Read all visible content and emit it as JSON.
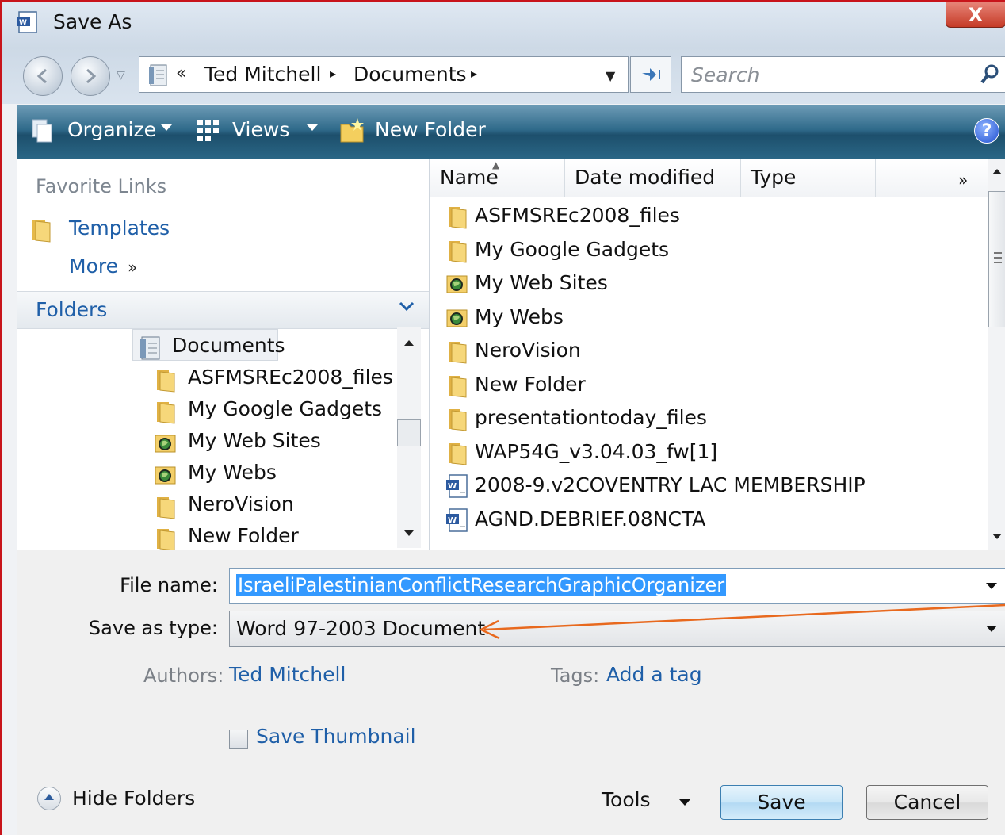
{
  "window": {
    "title": "Save As",
    "close_label": "X"
  },
  "address": {
    "prefix": "«",
    "crumbs": [
      "Ted Mitchell",
      "Documents"
    ],
    "separator": "▸"
  },
  "search": {
    "placeholder": "Search"
  },
  "toolbar": {
    "organize": "Organize",
    "views": "Views",
    "new_folder": "New Folder",
    "help": "?"
  },
  "nav": {
    "favorites_header": "Favorite Links",
    "favorites": [
      "Templates"
    ],
    "more": "More",
    "more_chevron": "»",
    "folders_label": "Folders",
    "tree": [
      {
        "label": "Documents",
        "icon": "documents-icon"
      },
      {
        "label": "ASFMSREc2008_files",
        "icon": "folder-icon"
      },
      {
        "label": "My Google Gadgets",
        "icon": "folder-icon"
      },
      {
        "label": "My Web Sites",
        "icon": "web-folder-icon"
      },
      {
        "label": "My Webs",
        "icon": "web-folder-icon"
      },
      {
        "label": "NeroVision",
        "icon": "folder-icon"
      },
      {
        "label": "New Folder",
        "icon": "folder-icon"
      }
    ]
  },
  "filelist": {
    "columns": [
      "Name",
      "Date modified",
      "Type"
    ],
    "more_columns": "»",
    "items": [
      {
        "label": "ASFMSREc2008_files",
        "icon": "folder-icon"
      },
      {
        "label": "My Google Gadgets",
        "icon": "folder-icon"
      },
      {
        "label": "My Web Sites",
        "icon": "web-folder-icon"
      },
      {
        "label": "My Webs",
        "icon": "web-folder-icon"
      },
      {
        "label": "NeroVision",
        "icon": "folder-icon"
      },
      {
        "label": "New Folder",
        "icon": "folder-icon"
      },
      {
        "label": "presentationtoday_files",
        "icon": "folder-icon"
      },
      {
        "label": "WAP54G_v3.04.03_fw[1]",
        "icon": "folder-icon"
      },
      {
        "label": "2008-9.v2COVENTRY LAC MEMBERSHIP",
        "icon": "word-doc-icon"
      },
      {
        "label": "AGND.DEBRIEF.08NCTA",
        "icon": "word-doc-icon"
      }
    ]
  },
  "form": {
    "filename_label": "File name:",
    "filename_value": "IsraeliPalestinianConflictResearchGraphicOrganizer",
    "type_label": "Save as type:",
    "type_value": "Word 97-2003 Document",
    "authors_label": "Authors:",
    "authors_value": "Ted Mitchell",
    "tags_label": "Tags:",
    "tags_value": "Add a tag",
    "save_thumbnail": "Save Thumbnail",
    "save_thumbnail_checked": false,
    "hide_folders": "Hide Folders",
    "tools": "Tools",
    "save": "Save",
    "cancel": "Cancel"
  },
  "colors": {
    "frame_border": "#c8141b",
    "toolbar": "#2f6a8a",
    "link": "#1f5fa8",
    "selection": "#3399ff",
    "annotation_arrow": "#e8691e"
  }
}
